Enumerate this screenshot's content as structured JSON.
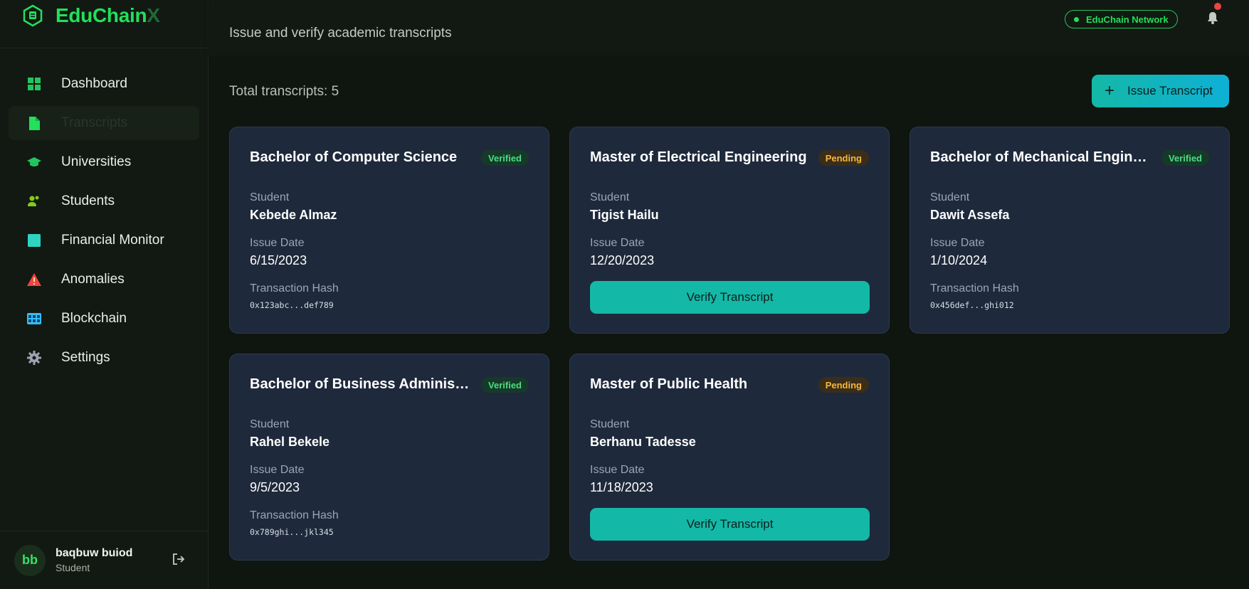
{
  "brand": {
    "name_main": "EduChain",
    "name_accent": "X"
  },
  "nav": [
    {
      "label": "Dashboard",
      "icon": "dashboard-icon"
    },
    {
      "label": "Transcripts",
      "icon": "document-icon"
    },
    {
      "label": "Universities",
      "icon": "graduation-cap-icon"
    },
    {
      "label": "Students",
      "icon": "users-icon"
    },
    {
      "label": "Financial Monitor",
      "icon": "chart-square-icon"
    },
    {
      "label": "Anomalies",
      "icon": "warning-icon"
    },
    {
      "label": "Blockchain",
      "icon": "blocks-icon"
    },
    {
      "label": "Settings",
      "icon": "gear-icon"
    }
  ],
  "active_nav": "Transcripts",
  "user": {
    "initials": "bb",
    "name": "baqbuw buiod",
    "role": "Student"
  },
  "header": {
    "subtitle": "Issue and verify academic transcripts",
    "network": "EduChain Network"
  },
  "main": {
    "total": "Total transcripts: 5",
    "issue_button": "Issue Transcript",
    "labels": {
      "student": "Student",
      "issue_date": "Issue Date",
      "hash": "Transaction Hash",
      "verify": "Verify Transcript"
    }
  },
  "transcripts": [
    {
      "title": "Bachelor of Computer Science",
      "status": "Verified",
      "student": "Kebede Almaz",
      "date": "6/15/2023",
      "hash": "0x123abc...def789"
    },
    {
      "title": "Master of Electrical Engineering",
      "status": "Pending",
      "student": "Tigist Hailu",
      "date": "12/20/2023",
      "hash": ""
    },
    {
      "title": "Bachelor of Mechanical Engineering",
      "status": "Verified",
      "student": "Dawit Assefa",
      "date": "1/10/2024",
      "hash": "0x456def...ghi012"
    },
    {
      "title": "Bachelor of Business Administration",
      "status": "Verified",
      "student": "Rahel Bekele",
      "date": "9/5/2023",
      "hash": "0x789ghi...jkl345"
    },
    {
      "title": "Master of Public Health",
      "status": "Pending",
      "student": "Berhanu Tadesse",
      "date": "11/18/2023",
      "hash": ""
    }
  ],
  "colors": {
    "accent": "#14b8a6",
    "brand_green": "#22e05a",
    "verified": "#4ade80",
    "pending": "#f6b73c",
    "notification": "#ef4444"
  }
}
